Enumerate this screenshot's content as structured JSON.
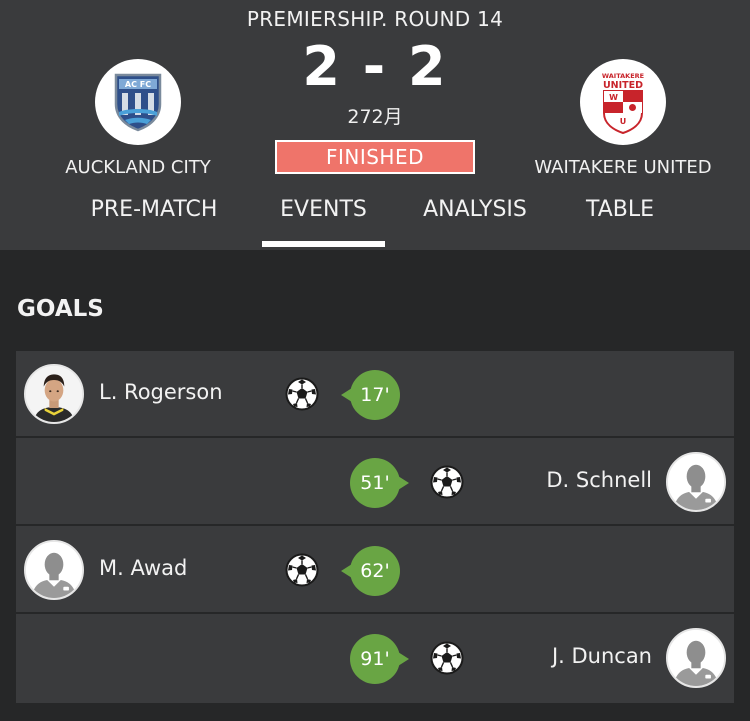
{
  "match": {
    "round_title": "PREMIERSHIP. ROUND 14",
    "home_team": "AUCKLAND CITY",
    "away_team": "WAITAKERE UNITED",
    "score": "2 - 2",
    "date": "272月",
    "status": "FINISHED",
    "status_color": "#ef746a"
  },
  "home_logo": {
    "icon": "auckland-city-crest-icon",
    "text": "AC FC"
  },
  "away_logo": {
    "icon": "waitakere-united-crest-icon",
    "line1": "WAITAKERE",
    "line2": "UNITED"
  },
  "tabs": [
    "PRE-MATCH",
    "EVENTS",
    "ANALYSIS",
    "TABLE"
  ],
  "active_tab": "EVENTS",
  "goals_section": {
    "title": "GOALS",
    "minute_color": "#69a544",
    "goals": [
      {
        "side": "home",
        "player": "L. Rogerson",
        "minute": "17'",
        "icon": "soccer-ball-icon",
        "avatar": "player-photo"
      },
      {
        "side": "away",
        "player": "D. Schnell",
        "minute": "51'",
        "icon": "soccer-ball-icon",
        "avatar": "avatar-placeholder-icon"
      },
      {
        "side": "home",
        "player": "M. Awad",
        "minute": "62'",
        "icon": "soccer-ball-icon",
        "avatar": "avatar-placeholder-icon"
      },
      {
        "side": "away",
        "player": "J. Duncan",
        "minute": "91'",
        "icon": "soccer-ball-icon",
        "avatar": "avatar-placeholder-icon"
      }
    ]
  }
}
